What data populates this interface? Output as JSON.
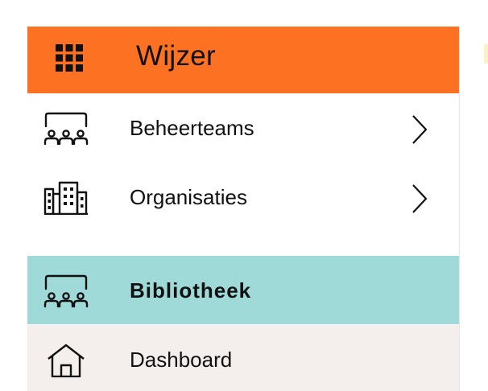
{
  "header": {
    "title": "Wijzer",
    "menu_icon": "app-grid-icon"
  },
  "menu": {
    "items": [
      {
        "label": "Beheerteams",
        "icon": "team-icon",
        "has_submenu": true,
        "active": false
      },
      {
        "label": "Organisaties",
        "icon": "buildings-icon",
        "has_submenu": true,
        "active": false
      },
      {
        "label": "Bibliotheek",
        "icon": "team-icon",
        "has_submenu": false,
        "active": true
      },
      {
        "label": "Dashboard",
        "icon": "home-icon",
        "has_submenu": false,
        "active": false
      }
    ]
  },
  "colors": {
    "header_bg": "#fc7222",
    "active_bg": "#9fdad9",
    "dashboard_bg": "#f4efec",
    "text": "#111111"
  }
}
